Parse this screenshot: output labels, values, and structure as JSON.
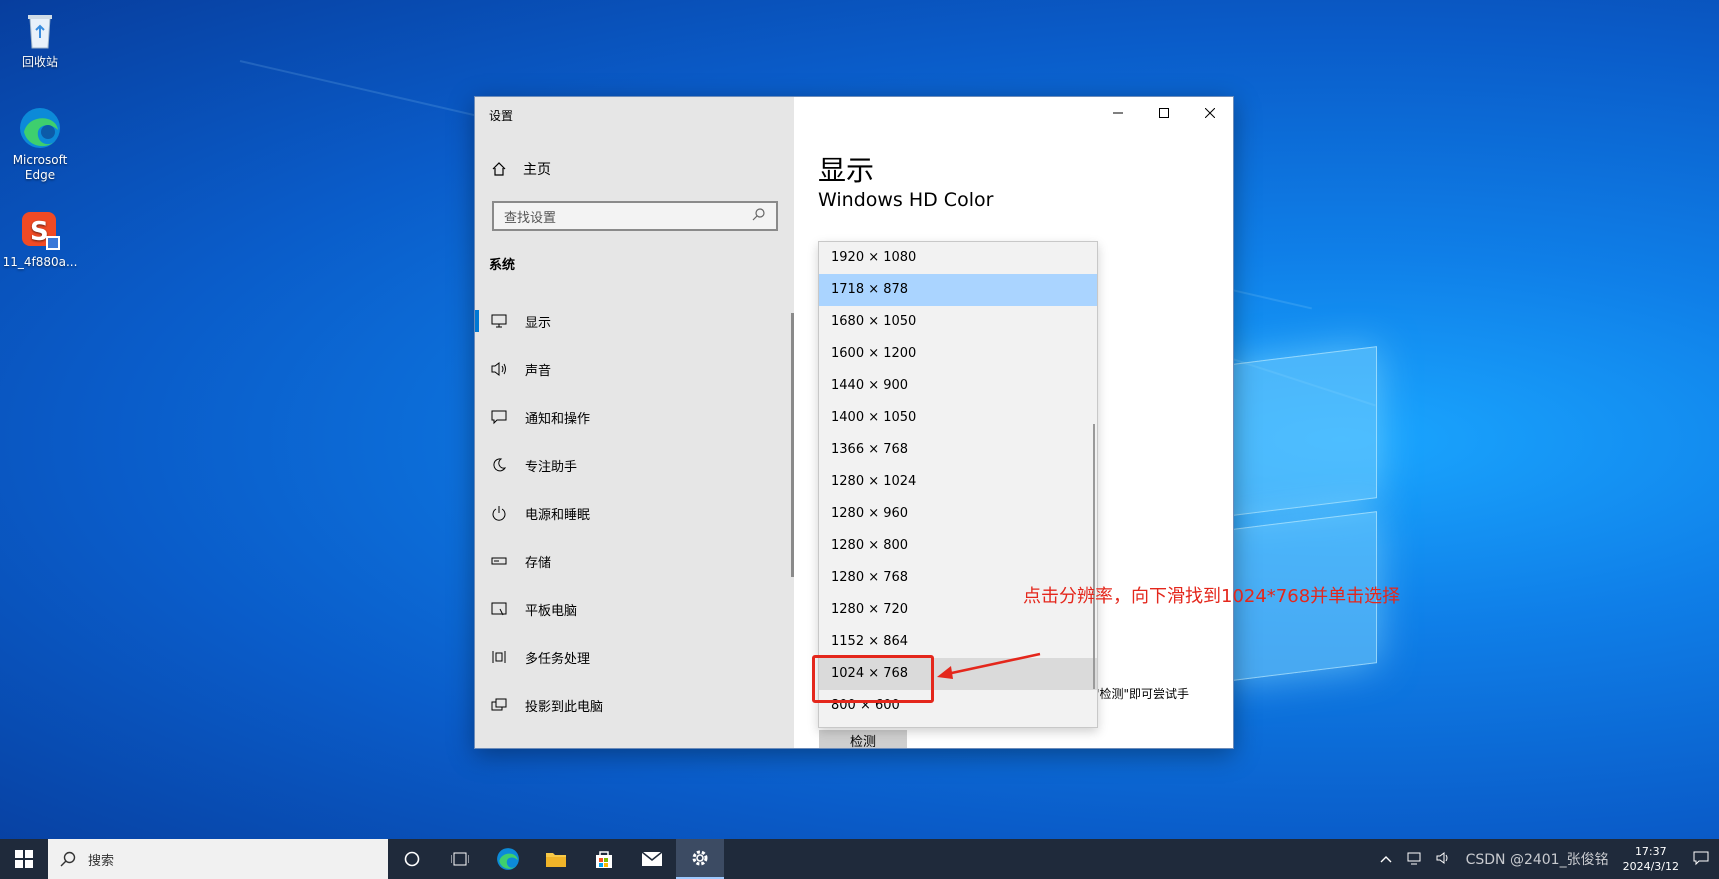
{
  "desktop": {
    "icons": [
      {
        "label": "回收站"
      },
      {
        "label": "Microsoft Edge"
      },
      {
        "label": "11_4f880a..."
      }
    ]
  },
  "window": {
    "title": "设置",
    "home_label": "主页",
    "search_placeholder": "查找设置",
    "section_label": "系统",
    "nav": [
      {
        "label": "显示",
        "icon": "monitor-icon"
      },
      {
        "label": "声音",
        "icon": "speaker-icon"
      },
      {
        "label": "通知和操作",
        "icon": "notification-icon"
      },
      {
        "label": "专注助手",
        "icon": "moon-icon"
      },
      {
        "label": "电源和睡眠",
        "icon": "power-icon"
      },
      {
        "label": "存储",
        "icon": "storage-icon"
      },
      {
        "label": "平板电脑",
        "icon": "tablet-icon"
      },
      {
        "label": "多任务处理",
        "icon": "multitask-icon"
      },
      {
        "label": "投影到此电脑",
        "icon": "project-icon"
      }
    ],
    "content": {
      "heading": "显示",
      "subheading": "Windows HD Color",
      "description": "",
      "hint": "\"检测\"即可尝试手",
      "detect_button": "检测"
    },
    "resolutions": [
      "1920 × 1080",
      "1718 × 878",
      "1680 × 1050",
      "1600 × 1200",
      "1440 × 900",
      "1400 × 1050",
      "1366 × 768",
      "1280 × 1024",
      "1280 × 960",
      "1280 × 800",
      "1280 × 768",
      "1280 × 720",
      "1152 × 864",
      "1024 × 768",
      "800 × 600"
    ],
    "selected_resolution": "1718 × 878",
    "highlighted_resolution": "1024 × 768"
  },
  "annotation": {
    "text": "点击分辨率，向下滑找到1024*768并单击选择",
    "color": "#e4271c"
  },
  "taskbar": {
    "search_placeholder": "搜索",
    "time": "17:37",
    "date": "2024/3/12",
    "watermark": "CSDN @2401_张俊铭"
  },
  "colors": {
    "accent": "#0078d4",
    "selected_item": "#aad4ff",
    "taskbar": "#1f2a3b"
  }
}
